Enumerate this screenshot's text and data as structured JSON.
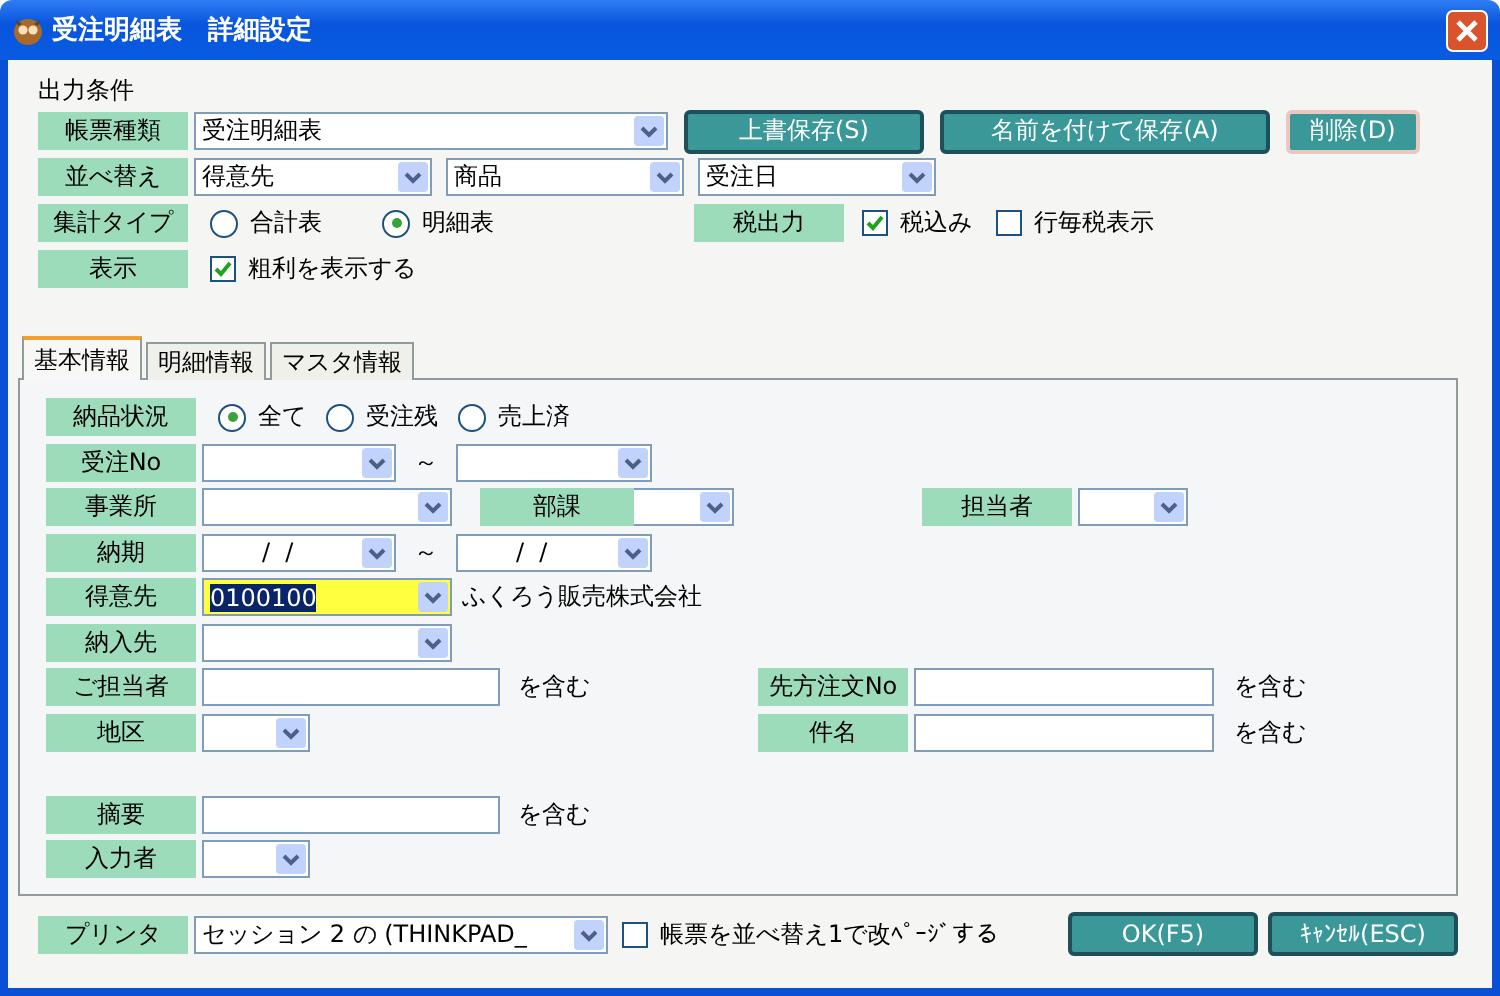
{
  "window": {
    "title": "受注明細表　詳細設定"
  },
  "output_conditions": {
    "heading": "出力条件",
    "report_type": {
      "label": "帳票種類",
      "value": "受注明細表"
    },
    "buttons": [
      "上書保存(S)",
      "名前を付けて保存(A)",
      "削除(D)"
    ],
    "sort": {
      "label": "並べ替え",
      "values": [
        "得意先",
        "商品",
        "受注日"
      ]
    },
    "summary_type": {
      "label": "集計タイプ",
      "options": [
        {
          "label": "合計表",
          "selected": false
        },
        {
          "label": "明細表",
          "selected": true
        }
      ]
    },
    "tax_output": {
      "label": "税出力",
      "options": [
        {
          "label": "税込み",
          "checked": true
        },
        {
          "label": "行毎税表示",
          "checked": false
        }
      ]
    },
    "display": {
      "label": "表示",
      "option": {
        "label": "粗利を表示する",
        "checked": true
      }
    }
  },
  "tabs": [
    {
      "label": "基本情報",
      "selected": true
    },
    {
      "label": "明細情報",
      "selected": false
    },
    {
      "label": "マスタ情報",
      "selected": false
    }
  ],
  "basic_info": {
    "delivery_status": {
      "label": "納品状況",
      "options": [
        {
          "label": "全て",
          "selected": true
        },
        {
          "label": "受注残",
          "selected": false
        },
        {
          "label": "売上済",
          "selected": false
        }
      ]
    },
    "order_no": {
      "label": "受注No",
      "tilde": "～"
    },
    "office": {
      "label": "事業所"
    },
    "department": {
      "label": "部課"
    },
    "staff": {
      "label": "担当者"
    },
    "due_date": {
      "label": "納期",
      "from": "/  /",
      "tilde": "～",
      "to": "/  /"
    },
    "customer": {
      "label": "得意先",
      "value": "0100100",
      "name": "ふくろう販売株式会社"
    },
    "ship_to": {
      "label": "納入先"
    },
    "contact": {
      "label": "ご担当者",
      "suffix": "を含む"
    },
    "customer_order_no": {
      "label": "先方注文No",
      "suffix": "を含む"
    },
    "area": {
      "label": "地区"
    },
    "subject": {
      "label": "件名",
      "suffix": "を含む"
    },
    "memo": {
      "label": "摘要",
      "suffix": "を含む"
    },
    "entered_by": {
      "label": "入力者"
    }
  },
  "footer": {
    "printer": {
      "label": "プリンタ",
      "value": "セッション 2 の (THINKPAD_"
    },
    "page_break": {
      "label": "帳票を並べ替え1で改ﾍﾟｰｼﾞする",
      "checked": false
    },
    "buttons": [
      "OK(F5)",
      "ｷｬﾝｾﾙ(ESC)"
    ]
  }
}
